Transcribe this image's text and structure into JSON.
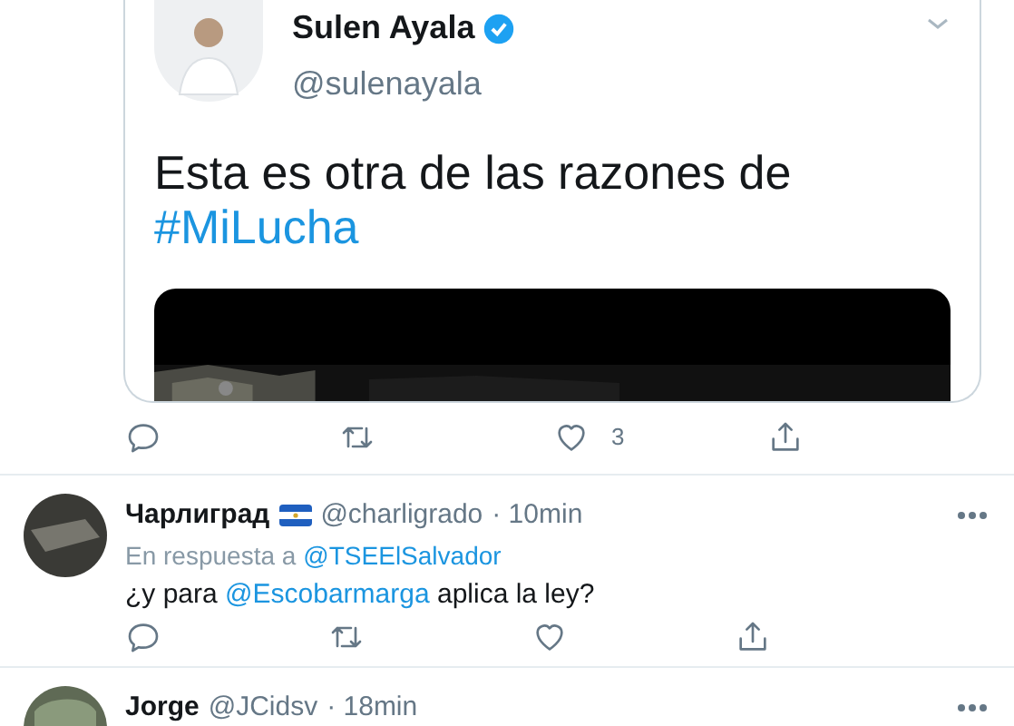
{
  "quoted_tweet": {
    "author_name": "Sulen Ayala",
    "verified": true,
    "handle": "@sulenayala",
    "text": "Esta es otra de las razones de",
    "hashtag": "#MiLucha"
  },
  "quoted_actions": [
    {
      "kind": "reply"
    },
    {
      "kind": "retweet"
    },
    {
      "kind": "like",
      "count": "3"
    },
    {
      "kind": "share"
    }
  ],
  "replies": [
    {
      "name": "Чарлиград",
      "has_flag": true,
      "handle": "@charligrado",
      "time": "· 10min",
      "reply_prefix": "En respuesta a",
      "reply_to": "@TSEElSalvador",
      "text_segments": [
        {
          "kind": "plain",
          "text": "¿y para"
        },
        {
          "kind": "mention",
          "text": "@Escobarmarga"
        },
        {
          "kind": "plain",
          "text": "aplica la ley?"
        }
      ],
      "actions": [
        {
          "kind": "reply"
        },
        {
          "kind": "retweet"
        },
        {
          "kind": "like"
        },
        {
          "kind": "share"
        }
      ]
    },
    {
      "name": "Jorge",
      "has_flag": false,
      "handle": "@JCidsv",
      "time": "· 18min"
    }
  ]
}
